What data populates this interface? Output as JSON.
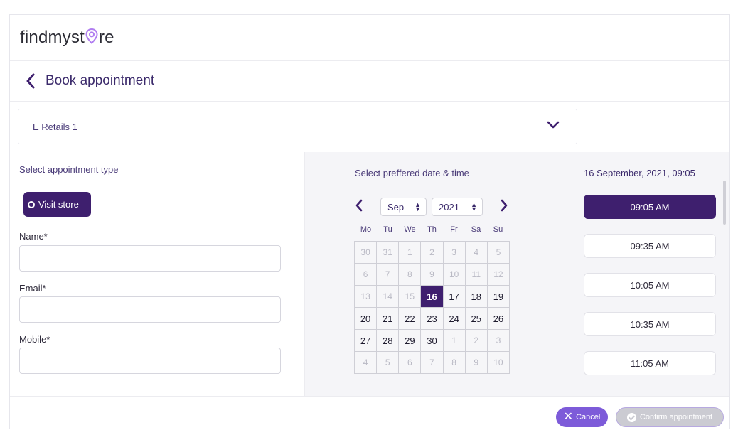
{
  "brand": {
    "text_before": "findmyst",
    "text_after": "re",
    "accent": "#b07df0"
  },
  "page": {
    "title": "Book appointment"
  },
  "store_select": {
    "value": "E Retails 1"
  },
  "form": {
    "type_label": "Select appointment type",
    "type_button": "Visit store",
    "name_label": "Name*",
    "email_label": "Email*",
    "mobile_label": "Mobile*",
    "name_value": "",
    "email_value": "",
    "mobile_value": ""
  },
  "calendar": {
    "title": "Select preffered date & time",
    "month": "Sep",
    "year": "2021",
    "weekdays": [
      "Mo",
      "Tu",
      "We",
      "Th",
      "Fr",
      "Sa",
      "Su"
    ],
    "weeks": [
      [
        "30",
        "31",
        "1",
        "2",
        "3",
        "4",
        "5"
      ],
      [
        "6",
        "7",
        "8",
        "9",
        "10",
        "11",
        "12"
      ],
      [
        "13",
        "14",
        "15",
        "16",
        "17",
        "18",
        "19"
      ],
      [
        "20",
        "21",
        "22",
        "23",
        "24",
        "25",
        "26"
      ],
      [
        "27",
        "28",
        "29",
        "30",
        "1",
        "2",
        "3"
      ],
      [
        "4",
        "5",
        "6",
        "7",
        "8",
        "9",
        "10"
      ]
    ],
    "selected": "16",
    "available": [
      "16",
      "17",
      "18",
      "19",
      "20",
      "21",
      "22",
      "23",
      "24",
      "25",
      "26",
      "27",
      "28",
      "29",
      "30"
    ]
  },
  "time": {
    "selected_label": "16 September, 2021, 09:05",
    "slots": [
      "09:05 AM",
      "09:35 AM",
      "10:05 AM",
      "10:35 AM",
      "11:05 AM"
    ],
    "selected_index": 0
  },
  "footer": {
    "cancel_label": "Cancel",
    "confirm_label": "Confirm appointment"
  },
  "colors": {
    "primary": "#3e1f6e",
    "cancel": "#7d5bd9",
    "disabled": "#cbcbd2"
  }
}
